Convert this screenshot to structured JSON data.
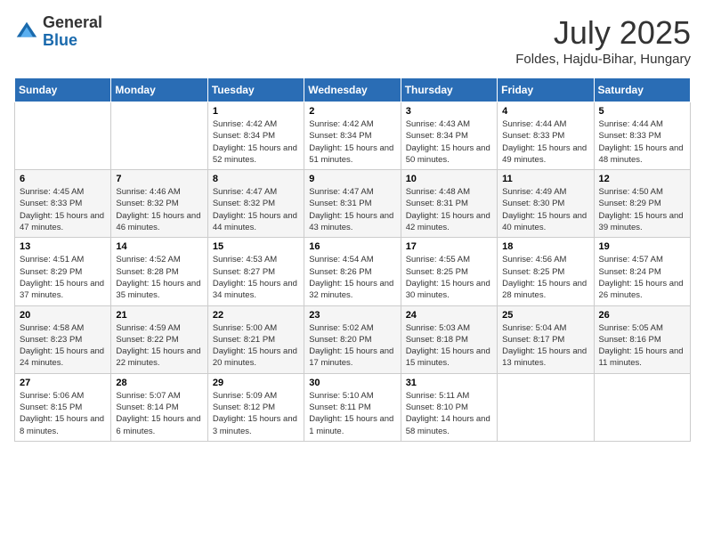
{
  "logo": {
    "general": "General",
    "blue": "Blue"
  },
  "title": {
    "month_year": "July 2025",
    "location": "Foldes, Hajdu-Bihar, Hungary"
  },
  "weekdays": [
    "Sunday",
    "Monday",
    "Tuesday",
    "Wednesday",
    "Thursday",
    "Friday",
    "Saturday"
  ],
  "weeks": [
    [
      {
        "day": "",
        "info": ""
      },
      {
        "day": "",
        "info": ""
      },
      {
        "day": "1",
        "info": "Sunrise: 4:42 AM\nSunset: 8:34 PM\nDaylight: 15 hours\nand 52 minutes."
      },
      {
        "day": "2",
        "info": "Sunrise: 4:42 AM\nSunset: 8:34 PM\nDaylight: 15 hours\nand 51 minutes."
      },
      {
        "day": "3",
        "info": "Sunrise: 4:43 AM\nSunset: 8:34 PM\nDaylight: 15 hours\nand 50 minutes."
      },
      {
        "day": "4",
        "info": "Sunrise: 4:44 AM\nSunset: 8:33 PM\nDaylight: 15 hours\nand 49 minutes."
      },
      {
        "day": "5",
        "info": "Sunrise: 4:44 AM\nSunset: 8:33 PM\nDaylight: 15 hours\nand 48 minutes."
      }
    ],
    [
      {
        "day": "6",
        "info": "Sunrise: 4:45 AM\nSunset: 8:33 PM\nDaylight: 15 hours\nand 47 minutes."
      },
      {
        "day": "7",
        "info": "Sunrise: 4:46 AM\nSunset: 8:32 PM\nDaylight: 15 hours\nand 46 minutes."
      },
      {
        "day": "8",
        "info": "Sunrise: 4:47 AM\nSunset: 8:32 PM\nDaylight: 15 hours\nand 44 minutes."
      },
      {
        "day": "9",
        "info": "Sunrise: 4:47 AM\nSunset: 8:31 PM\nDaylight: 15 hours\nand 43 minutes."
      },
      {
        "day": "10",
        "info": "Sunrise: 4:48 AM\nSunset: 8:31 PM\nDaylight: 15 hours\nand 42 minutes."
      },
      {
        "day": "11",
        "info": "Sunrise: 4:49 AM\nSunset: 8:30 PM\nDaylight: 15 hours\nand 40 minutes."
      },
      {
        "day": "12",
        "info": "Sunrise: 4:50 AM\nSunset: 8:29 PM\nDaylight: 15 hours\nand 39 minutes."
      }
    ],
    [
      {
        "day": "13",
        "info": "Sunrise: 4:51 AM\nSunset: 8:29 PM\nDaylight: 15 hours\nand 37 minutes."
      },
      {
        "day": "14",
        "info": "Sunrise: 4:52 AM\nSunset: 8:28 PM\nDaylight: 15 hours\nand 35 minutes."
      },
      {
        "day": "15",
        "info": "Sunrise: 4:53 AM\nSunset: 8:27 PM\nDaylight: 15 hours\nand 34 minutes."
      },
      {
        "day": "16",
        "info": "Sunrise: 4:54 AM\nSunset: 8:26 PM\nDaylight: 15 hours\nand 32 minutes."
      },
      {
        "day": "17",
        "info": "Sunrise: 4:55 AM\nSunset: 8:25 PM\nDaylight: 15 hours\nand 30 minutes."
      },
      {
        "day": "18",
        "info": "Sunrise: 4:56 AM\nSunset: 8:25 PM\nDaylight: 15 hours\nand 28 minutes."
      },
      {
        "day": "19",
        "info": "Sunrise: 4:57 AM\nSunset: 8:24 PM\nDaylight: 15 hours\nand 26 minutes."
      }
    ],
    [
      {
        "day": "20",
        "info": "Sunrise: 4:58 AM\nSunset: 8:23 PM\nDaylight: 15 hours\nand 24 minutes."
      },
      {
        "day": "21",
        "info": "Sunrise: 4:59 AM\nSunset: 8:22 PM\nDaylight: 15 hours\nand 22 minutes."
      },
      {
        "day": "22",
        "info": "Sunrise: 5:00 AM\nSunset: 8:21 PM\nDaylight: 15 hours\nand 20 minutes."
      },
      {
        "day": "23",
        "info": "Sunrise: 5:02 AM\nSunset: 8:20 PM\nDaylight: 15 hours\nand 17 minutes."
      },
      {
        "day": "24",
        "info": "Sunrise: 5:03 AM\nSunset: 8:18 PM\nDaylight: 15 hours\nand 15 minutes."
      },
      {
        "day": "25",
        "info": "Sunrise: 5:04 AM\nSunset: 8:17 PM\nDaylight: 15 hours\nand 13 minutes."
      },
      {
        "day": "26",
        "info": "Sunrise: 5:05 AM\nSunset: 8:16 PM\nDaylight: 15 hours\nand 11 minutes."
      }
    ],
    [
      {
        "day": "27",
        "info": "Sunrise: 5:06 AM\nSunset: 8:15 PM\nDaylight: 15 hours\nand 8 minutes."
      },
      {
        "day": "28",
        "info": "Sunrise: 5:07 AM\nSunset: 8:14 PM\nDaylight: 15 hours\nand 6 minutes."
      },
      {
        "day": "29",
        "info": "Sunrise: 5:09 AM\nSunset: 8:12 PM\nDaylight: 15 hours\nand 3 minutes."
      },
      {
        "day": "30",
        "info": "Sunrise: 5:10 AM\nSunset: 8:11 PM\nDaylight: 15 hours\nand 1 minute."
      },
      {
        "day": "31",
        "info": "Sunrise: 5:11 AM\nSunset: 8:10 PM\nDaylight: 14 hours\nand 58 minutes."
      },
      {
        "day": "",
        "info": ""
      },
      {
        "day": "",
        "info": ""
      }
    ]
  ]
}
